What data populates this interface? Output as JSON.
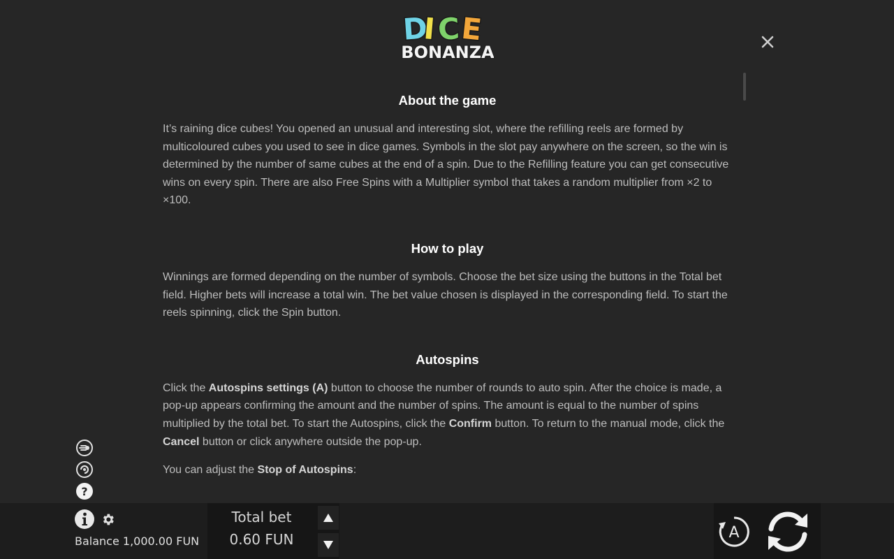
{
  "logo": {
    "line1": "DICE",
    "line2": "BONANZA"
  },
  "sections": {
    "about": {
      "title": "About the game",
      "text": "It’s raining dice cubes! You opened an unusual and interesting slot, where the refilling reels are formed by multicoloured cubes you used to see in dice games. Symbols in the slot pay anywhere on the screen, so the win is determined by the number of same cubes at the end of a spin. Due to the Refilling feature you can get consecutive wins on every spin. There are also Free Spins with a Multiplier symbol that takes a random multiplier from ×2 to ×100."
    },
    "how_to_play": {
      "title": "How to play",
      "text": "Winnings are formed depending on the number of symbols. Choose the bet size using the buttons in the Total bet field. Higher bets will increase a total win. The bet value chosen is displayed in the corresponding field. To start the reels spinning, click the Spin button."
    },
    "autospins": {
      "title": "Autospins",
      "t1": "Click the ",
      "b1": "Autospins settings (A)",
      "t2": " button to choose the number of rounds to auto spin. After the choice is made, a pop-up appears confirming the amount and the number of spins. The amount is equal to the number of spins multiplied by the total bet. To start the Autospins, click the ",
      "b2": "Confirm",
      "t3": " button. To return to the manual mode, click the ",
      "b3": "Cancel",
      "t4": " button or click anywhere outside the pop-up.",
      "stop_t1": "You can adjust the ",
      "stop_b1": "Stop of Autospins",
      "stop_t2": ":"
    }
  },
  "bottom_bar": {
    "balance_label": "Balance",
    "balance_value": "1,000.00 FUN",
    "total_bet_label": "Total bet",
    "total_bet_value": "0.60 FUN",
    "autospin_letter": "A"
  },
  "side_icons": [
    "turbo-icon",
    "quick-spin-icon",
    "help-icon"
  ],
  "colors": {
    "background": "#262626",
    "heading": "#ffffff",
    "body_text": "#bdbdbd",
    "bar": "#1d1d1d"
  }
}
